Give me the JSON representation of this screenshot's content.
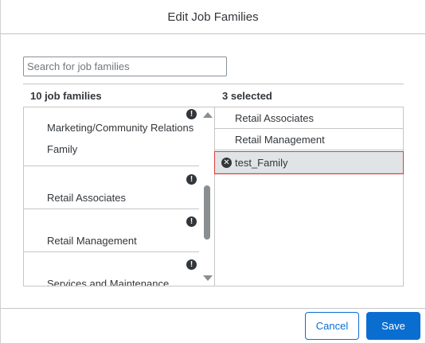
{
  "dialog": {
    "title": "Edit Job Families"
  },
  "search": {
    "placeholder": "Search for job families",
    "value": ""
  },
  "available": {
    "header": "10 job families",
    "items": [
      {
        "label": "Marketing/Community Relations Family",
        "alert": "!"
      },
      {
        "label": "Retail Associates",
        "alert": "!"
      },
      {
        "label": "Retail Management",
        "alert": "!"
      },
      {
        "label": "Services and Maintenance",
        "alert": "!"
      }
    ]
  },
  "selected": {
    "header": "3 selected",
    "items": [
      {
        "label": "Retail Associates"
      },
      {
        "label": "Retail Management"
      },
      {
        "label": "test_Family",
        "remove_glyph": "✕"
      }
    ]
  },
  "footer": {
    "cancel_label": "Cancel",
    "save_label": "Save"
  },
  "colors": {
    "accent": "#0a6ed1",
    "highlight_border": "#e03e3e",
    "highlight_bg": "#e1e4e6"
  }
}
